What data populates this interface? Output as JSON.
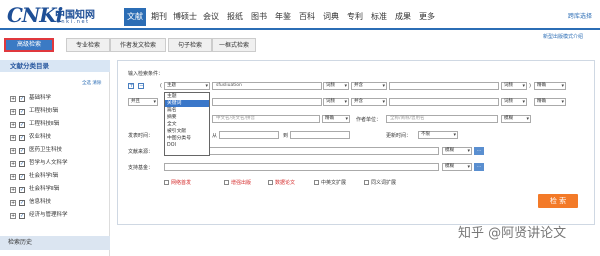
{
  "logo": {
    "cnki": "CNKi",
    "cn": "中国知网",
    "sub": "c n k i . n e t"
  },
  "nav": {
    "items": [
      "文献",
      "期刊",
      "博硕士",
      "会议",
      "报纸",
      "图书",
      "年鉴",
      "百科",
      "词典",
      "专利",
      "标准",
      "成果",
      "更多"
    ]
  },
  "topright": "跨库选择",
  "tabs": [
    "高级检索",
    "专业检索",
    "作者发文检索",
    "句子检索",
    "一框式检索"
  ],
  "newver": "新型出版模式介绍",
  "sidebar": {
    "title": "文献分类目录",
    "links": "全选  清除",
    "items": [
      "基础科学",
      "工程科技Ⅰ辑",
      "工程科技Ⅱ辑",
      "农业科技",
      "医药卫生科技",
      "哲学与人文科学",
      "社会科学Ⅰ辑",
      "社会科学Ⅱ辑",
      "信息科技",
      "经济与管理科学"
    ],
    "history": "检索历史"
  },
  "form": {
    "condition_label": "输入检索条件：",
    "row1": {
      "field": "主题",
      "value": "sfusliuation",
      "freq": "词频",
      "op": "并含",
      "freq2": "词频",
      "match": "精确"
    },
    "row2": {
      "conj": "并且",
      "field": "篇名",
      "freq": "词频",
      "op": "并含",
      "freq2": "词频",
      "match": "精确"
    },
    "row3": {
      "author_field": "作者",
      "author_hint": "中文名/英文名/拼音",
      "match": "精确",
      "unit_label": "作者单位：",
      "unit_hint": "全称/简称/曾用名",
      "match2": "模糊"
    },
    "row4": {
      "time_label": "发表时间：",
      "from": "从",
      "to": "到",
      "update_label": "更新时间：",
      "update_value": "不限"
    },
    "row5": {
      "source_label": "文献来源：",
      "match": "模糊"
    },
    "row6": {
      "fund_label": "支持基金：",
      "match": "模糊"
    },
    "checkboxes": [
      "网络首发",
      "增强出版",
      "数据论文",
      "中英文扩展",
      "同义词扩展"
    ],
    "dropdown": [
      "主题",
      "关键词",
      "篇名",
      "摘要",
      "全文",
      "被引文献",
      "中图分类号",
      "DOI"
    ],
    "dropdown_selected": 1,
    "search_button": "检 索"
  },
  "watermark": "知乎 @阿贤讲论文"
}
